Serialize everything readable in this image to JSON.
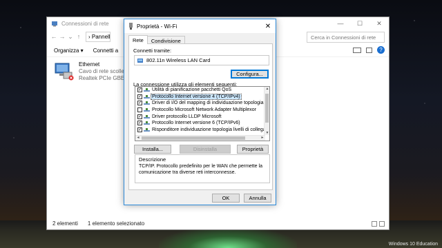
{
  "explorer": {
    "title": "Connessioni di rete",
    "path": "Pannello",
    "search_placeholder": "Cerca in Connessioni di rete",
    "commands": [
      "Organizza ▾",
      "Connetti a"
    ],
    "item": {
      "name": "Ethernet",
      "status": "Cavo di rete scollegato",
      "device": "Realtek PCIe GBE Family"
    },
    "status_bar": {
      "count": "2 elementi",
      "selected": "1 elemento selezionato"
    }
  },
  "dialog": {
    "title": "Proprietà - Wi-Fi",
    "tabs": [
      "Rete",
      "Condivisione"
    ],
    "connect_using_label": "Connetti tramite:",
    "adapter_name": "802.11n Wireless LAN Card",
    "configure_button": "Configura...",
    "items_label": "La connessione utilizza gli elementi seguenti:",
    "items": [
      {
        "label": "Utilità di pianificazione pacchetti QoS",
        "checked": true,
        "selected": false
      },
      {
        "label": "Protocollo Internet versione 4 (TCP/IPv4)",
        "checked": true,
        "selected": true
      },
      {
        "label": "Driver di I/O del mapping di individuazione topologia livelli c",
        "checked": true,
        "selected": false
      },
      {
        "label": "Protocollo Microsoft Network Adapter Multiplexor",
        "checked": false,
        "selected": false
      },
      {
        "label": "Driver protocollo LLDP Microsoft",
        "checked": true,
        "selected": false
      },
      {
        "label": "Protocollo Internet versione 6 (TCP/IPv6)",
        "checked": true,
        "selected": false
      },
      {
        "label": "Risponditore individuazione topologia livelli di collegamento",
        "checked": true,
        "selected": false
      }
    ],
    "install_button": "Installa...",
    "uninstall_button": "Disinstalla",
    "properties_button": "Proprietà",
    "description_title": "Descrizione",
    "description_text": "TCP/IP. Protocollo predefinito per le WAN che permette la comunicazione tra diverse reti interconnesse.",
    "ok_button": "OK",
    "cancel_button": "Annulla"
  },
  "desktop": {
    "watermark": "Windows 10 Education"
  },
  "colors": {
    "accent": "#0078d7",
    "selection": "#cce8ff",
    "glow": "#6fe08a"
  }
}
